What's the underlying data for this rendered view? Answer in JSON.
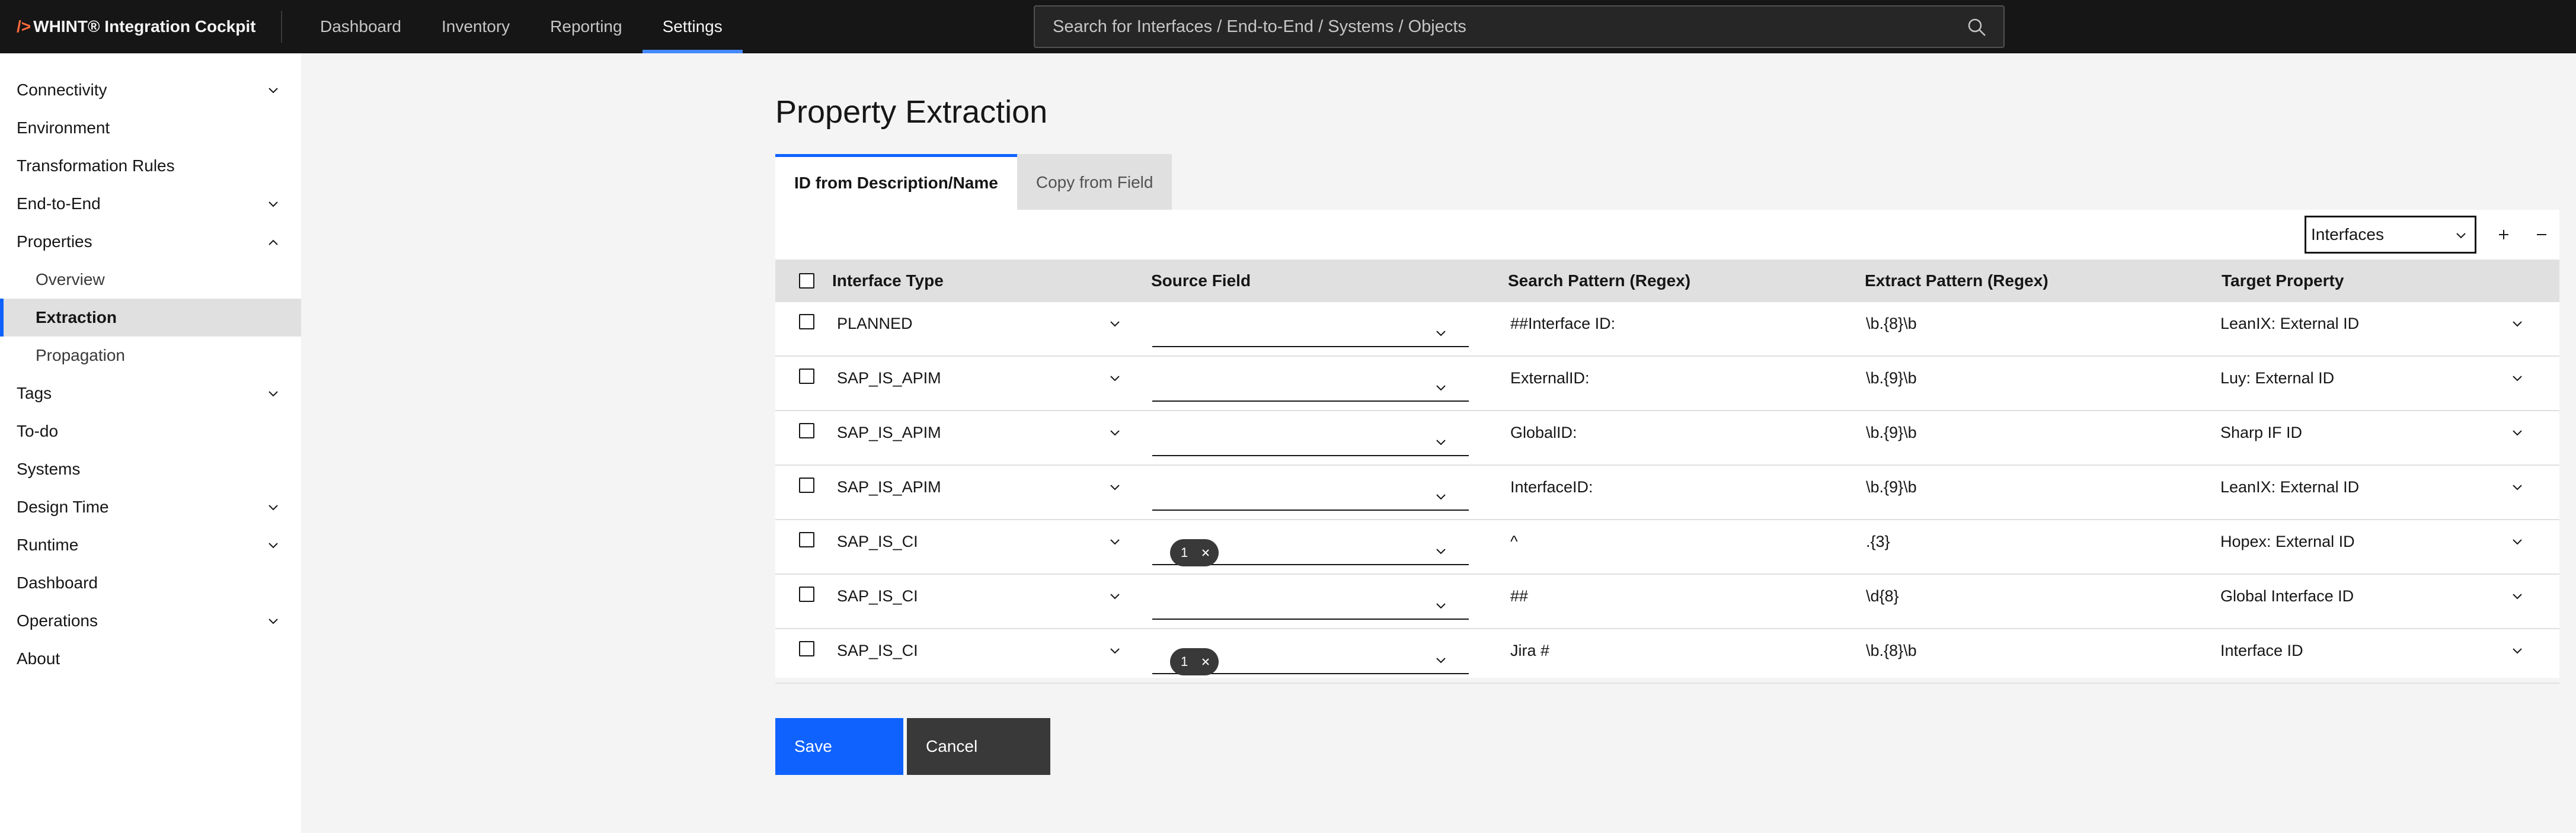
{
  "app": {
    "title": "WHINT® Integration Cockpit",
    "logo_symbol": "/>"
  },
  "nav": [
    {
      "label": "Dashboard",
      "active": false
    },
    {
      "label": "Inventory",
      "active": false
    },
    {
      "label": "Reporting",
      "active": false
    },
    {
      "label": "Settings",
      "active": true
    }
  ],
  "search": {
    "placeholder": "Search for Interfaces / End-to-End / Systems / Objects",
    "value": ""
  },
  "sidebar": {
    "items": [
      {
        "label": "Connectivity",
        "chevron": "down"
      },
      {
        "label": "Environment"
      },
      {
        "label": "Transformation Rules"
      },
      {
        "label": "End-to-End",
        "chevron": "down"
      },
      {
        "label": "Properties",
        "chevron": "up"
      },
      {
        "label": "Overview",
        "sub": true
      },
      {
        "label": "Extraction",
        "sub": true,
        "active": true
      },
      {
        "label": "Propagation",
        "sub": true
      },
      {
        "label": "Tags",
        "chevron": "down"
      },
      {
        "label": "To-do"
      },
      {
        "label": "Systems"
      },
      {
        "label": "Design Time",
        "chevron": "down"
      },
      {
        "label": "Runtime",
        "chevron": "down"
      },
      {
        "label": "Dashboard"
      },
      {
        "label": "Operations",
        "chevron": "down"
      },
      {
        "label": "About"
      }
    ]
  },
  "page": {
    "title": "Property Extraction"
  },
  "tabs": [
    {
      "label": "ID from Description/Name",
      "active": true
    },
    {
      "label": "Copy from Field",
      "active": false
    }
  ],
  "toolbar": {
    "selected_type": "Interfaces"
  },
  "table": {
    "headers": {
      "interface_type": "Interface Type",
      "source_field": "Source Field",
      "search_pattern": "Search Pattern (Regex)",
      "extract_pattern": "Extract Pattern (Regex)",
      "target_property": "Target Property"
    },
    "rows": [
      {
        "interface_type": "PLANNED",
        "source_tag": "",
        "search_pattern": "##Interface ID:",
        "extract_pattern": "\\b.{8}\\b",
        "target_property": "LeanIX: External ID"
      },
      {
        "interface_type": "SAP_IS_APIM",
        "source_tag": "",
        "search_pattern": "ExternalID:",
        "extract_pattern": "\\b.{9}\\b",
        "target_property": "Luy: External ID"
      },
      {
        "interface_type": "SAP_IS_APIM",
        "source_tag": "",
        "search_pattern": "GlobalID:",
        "extract_pattern": "\\b.{9}\\b",
        "target_property": "Sharp IF ID"
      },
      {
        "interface_type": "SAP_IS_APIM",
        "source_tag": "",
        "search_pattern": "InterfaceID:",
        "extract_pattern": "\\b.{9}\\b",
        "target_property": "LeanIX: External ID"
      },
      {
        "interface_type": "SAP_IS_CI",
        "source_tag": "1",
        "search_pattern": "^",
        "extract_pattern": ".{3}",
        "target_property": "Hopex: External ID"
      },
      {
        "interface_type": "SAP_IS_CI",
        "source_tag": "",
        "search_pattern": "##",
        "extract_pattern": "\\d{8}",
        "target_property": "Global Interface ID"
      },
      {
        "interface_type": "SAP_IS_CI",
        "source_tag": "1",
        "search_pattern": "Jira #",
        "extract_pattern": "\\b.{8}\\b",
        "target_property": "Interface ID"
      }
    ]
  },
  "actions": {
    "save_label": "Save",
    "cancel_label": "Cancel"
  },
  "icons": {
    "search": "search-icon",
    "chevron": "chevron-icon",
    "add": "plus-icon",
    "remove": "minus-icon",
    "tag_remove": "close-icon"
  },
  "colors": {
    "topbar": "#161616",
    "accent": "#0f62fe",
    "nav_underline": "#4589ff",
    "logo_slash": "#ff6b3d"
  }
}
